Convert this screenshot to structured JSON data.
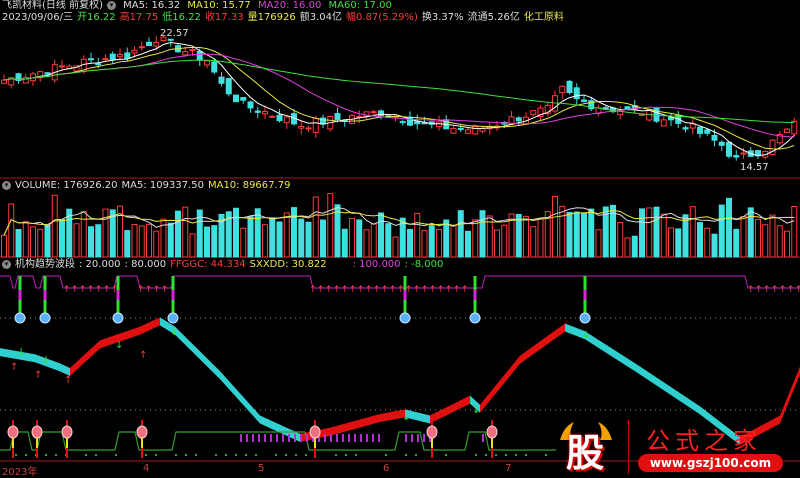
{
  "main": {
    "title": "飞凯材料(日线 前复权)",
    "ma5": "MA5: 16.32",
    "ma10": "MA10: 15.77",
    "ma20": "MA20: 16.00",
    "ma60": "MA60: 17.00",
    "date": "2023/09/06/三",
    "open": "开16.22",
    "high": "高17.75",
    "low": "低16.22",
    "close": "收17.33",
    "vol": "量176926",
    "amount": "额3.04亿",
    "change": "幅0.87(5.29%)",
    "turnover": "换3.37%",
    "float": "流通5.26亿",
    "sector": "化工原料",
    "high_label": "22.57",
    "low_label": "14.57",
    "price_keypoints": [
      [
        0,
        19.68
      ],
      [
        6,
        20.28
      ],
      [
        11,
        20.76
      ],
      [
        17,
        21.18
      ],
      [
        21,
        22.2
      ],
      [
        23,
        21.79
      ],
      [
        28,
        20.88
      ],
      [
        30,
        19.38
      ],
      [
        33,
        18.17
      ],
      [
        36,
        17.75
      ],
      [
        41,
        16.97
      ],
      [
        47,
        17.39
      ],
      [
        52,
        17.75
      ],
      [
        58,
        16.97
      ],
      [
        65,
        16.67
      ],
      [
        72,
        17.57
      ],
      [
        75,
        17.87
      ],
      [
        77,
        19.08
      ],
      [
        79,
        18.47
      ],
      [
        83,
        17.99
      ],
      [
        88,
        17.75
      ],
      [
        94,
        16.97
      ],
      [
        99,
        15.76
      ],
      [
        101,
        14.86
      ],
      [
        105,
        15.58
      ],
      [
        109,
        16.97
      ]
    ]
  },
  "volume": {
    "label": "VOLUME: 176926.20",
    "ma5": "MA5: 109337.50",
    "ma10": "MA10: 89667.79"
  },
  "indicator": {
    "name": "机构趋势波段",
    "v1": ": 20.000",
    "v2": ": 80.000",
    "ffggc": "FFGGC: 44.334",
    "sxxdd": "SXXDD: 30.822",
    "v3": ": 100.000",
    "v4": ": -8.000",
    "curve": [
      [
        0,
        58
      ],
      [
        35,
        54
      ],
      [
        60,
        48
      ],
      [
        70,
        45
      ],
      [
        100,
        63
      ],
      [
        140,
        72
      ],
      [
        160,
        78
      ],
      [
        175,
        72
      ],
      [
        220,
        43
      ],
      [
        260,
        14
      ],
      [
        300,
        2
      ],
      [
        330,
        6
      ],
      [
        380,
        15
      ],
      [
        405,
        18
      ],
      [
        430,
        14
      ],
      [
        470,
        27
      ],
      [
        480,
        21
      ],
      [
        520,
        53
      ],
      [
        565,
        74
      ],
      [
        585,
        69
      ],
      [
        640,
        46
      ],
      [
        700,
        20
      ],
      [
        740,
        0
      ],
      [
        780,
        14
      ],
      [
        800,
        46
      ]
    ]
  },
  "axis": {
    "labels": [
      "2023年",
      "4",
      "5",
      "6",
      "7"
    ]
  },
  "watermark": {
    "char": "股",
    "name": "公式之家",
    "url": "www.gszj100.com"
  },
  "colors": {
    "up": "#ff3a3a",
    "down": "#40e0e0",
    "ma5": "#ffffff",
    "ma10": "#e8e84a",
    "ma20": "#e040e0",
    "ma60": "#3ce03c"
  }
}
